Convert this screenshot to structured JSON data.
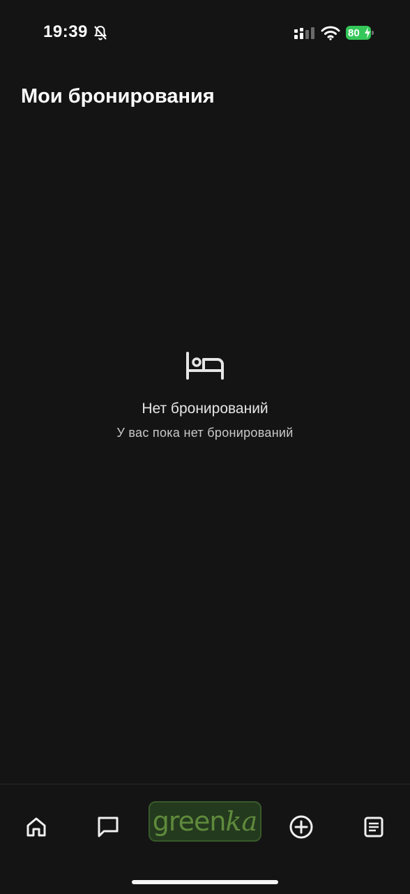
{
  "status_bar": {
    "time": "19:39",
    "battery_level": "80",
    "icons": [
      "bell-off-icon",
      "signal-icon",
      "wifi-icon",
      "battery-icon"
    ]
  },
  "page": {
    "title": "Мои бронирования"
  },
  "empty_state": {
    "icon": "bed-icon",
    "title": "Нет бронирований",
    "subtitle": "У вас пока нет бронирований"
  },
  "bottom_nav": {
    "items": [
      {
        "icon": "home-icon"
      },
      {
        "icon": "chat-icon"
      },
      {
        "brand_main": "green",
        "brand_accent": "ka"
      },
      {
        "icon": "add-circle-icon"
      },
      {
        "icon": "bookings-list-icon"
      }
    ]
  },
  "colors": {
    "background": "#141414",
    "text_primary": "#ffffff",
    "text_secondary": "#c9c9c9",
    "battery_green": "#34c759",
    "brand_green": "#5f8a3c",
    "brand_bg": "#243a1e"
  }
}
